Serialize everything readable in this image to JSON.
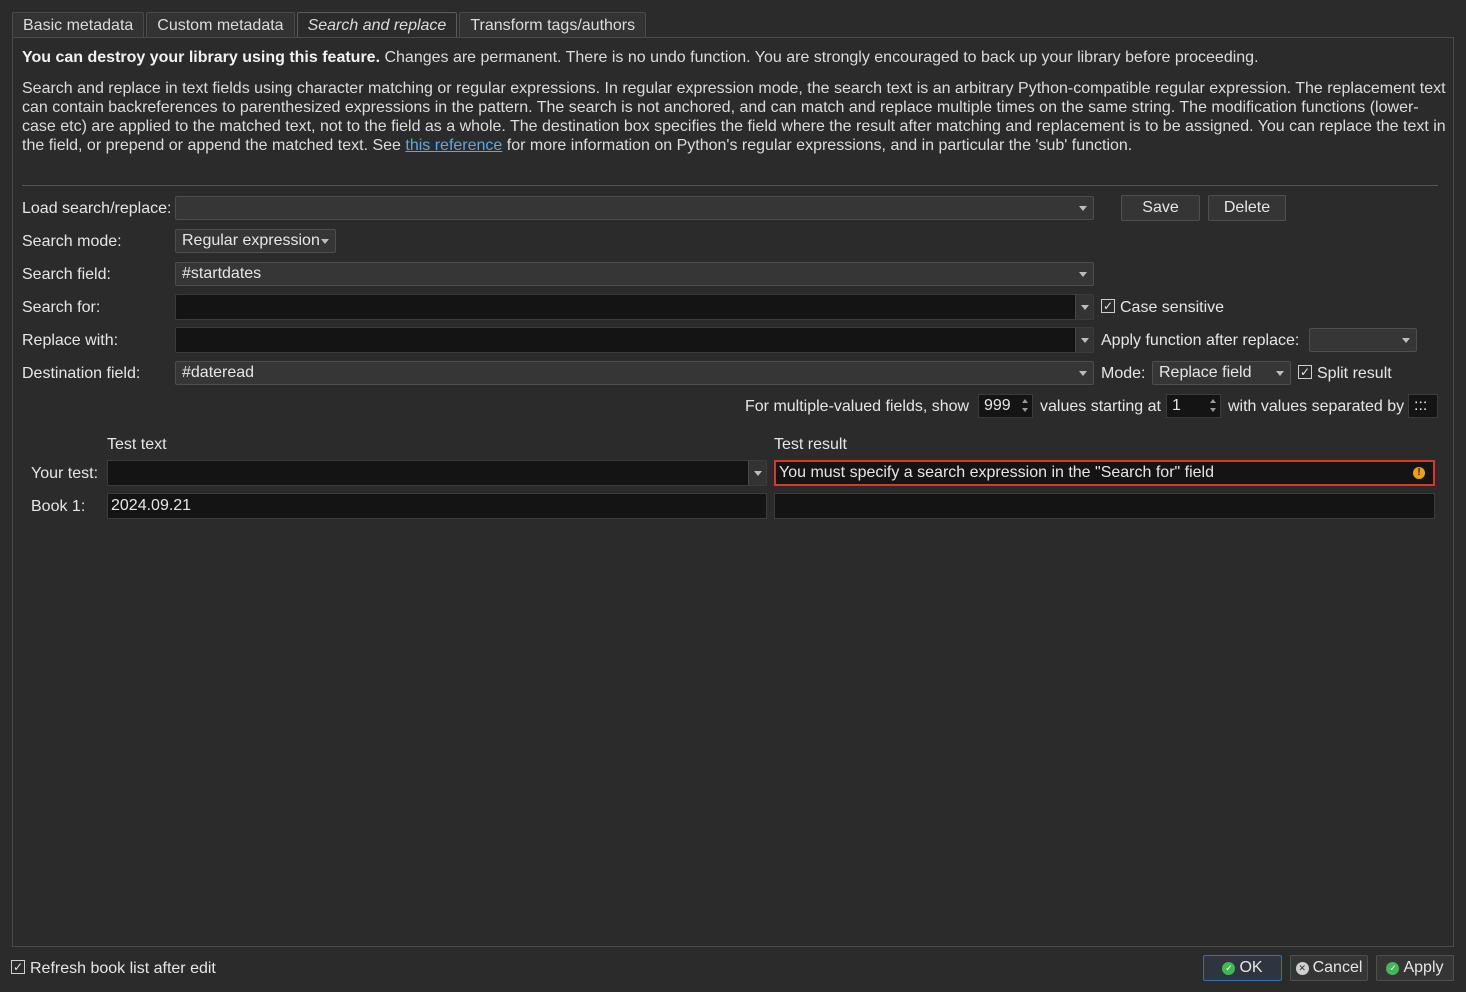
{
  "tabs": [
    {
      "label": "Basic metadata"
    },
    {
      "label": "Custom metadata"
    },
    {
      "label": "Search and replace"
    },
    {
      "label": "Transform tags/authors"
    }
  ],
  "warning": {
    "bold": "You can destroy your library using this feature.",
    "rest": " Changes are permanent. There is no undo function. You are strongly encouraged to back up your library before proceeding."
  },
  "help": {
    "before_link": "Search and replace in text fields using character matching or regular expressions. In regular expression mode, the search text is an arbitrary Python-compatible regular expression. The replacement text can contain backreferences to parenthesized expressions in the pattern. The search is not anchored, and can match and replace multiple times on the same string. The modification functions (lower-case etc) are applied to the matched text, not to the field as a whole. The destination box specifies the field where the result after matching and replacement is to be assigned. You can replace the text in the field, or prepend or append the matched text. See ",
    "link": "this reference",
    "after_link": " for more information on Python's regular expressions, and in particular the 'sub' function."
  },
  "form": {
    "load_label": "Load search/replace:",
    "load_value": "",
    "save_label": "Save",
    "delete_label": "Delete",
    "mode_label": "Search mode:",
    "mode_value": "Regular expression",
    "field_label": "Search field:",
    "field_value": "#startdates",
    "search_for_label": "Search for:",
    "search_for_value": "",
    "case_sensitive_label": "Case sensitive",
    "case_sensitive_checked": true,
    "replace_label": "Replace with:",
    "replace_value": "",
    "apply_function_label": "Apply function after replace:",
    "apply_function_value": "",
    "dest_label": "Destination field:",
    "dest_value": "#dateread",
    "dest_mode_label": "Mode:",
    "dest_mode_value": "Replace field",
    "split_result_label": "Split result",
    "split_result_checked": true,
    "multi_prefix": "For multiple-valued fields, show",
    "multi_show_value": "999",
    "multi_mid": "values starting at",
    "multi_start_value": "1",
    "multi_suffix": "with values separated by",
    "multi_sep_value": ":::"
  },
  "test": {
    "col_text": "Test text",
    "col_result": "Test result",
    "your_test_label": "Your test:",
    "your_test_value": "",
    "your_test_result": "You must specify a search expression in the \"Search for\" field",
    "book1_label": "Book 1:",
    "book1_value": "2024.09.21",
    "book1_result": ""
  },
  "footer": {
    "refresh_label": "Refresh book list after edit",
    "refresh_checked": true,
    "ok_label": "OK",
    "cancel_label": "Cancel",
    "apply_label": "Apply"
  },
  "colors": {
    "background": "#2b2b2b",
    "link": "#5aa9e6",
    "error_border": "#d93a1f",
    "warning_icon": "#f0a000",
    "ok_icon": "#3fb950"
  }
}
